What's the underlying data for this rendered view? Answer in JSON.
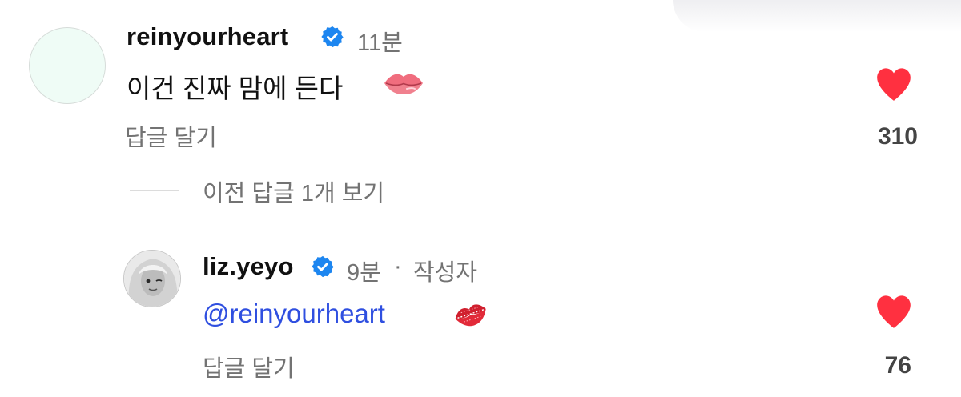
{
  "comment": {
    "username": "reinyourheart",
    "verified_icon": "verified-badge-icon",
    "time": "11분",
    "text": "이건 진짜 맘에 든다",
    "emoji": "lips",
    "reply_label": "답글 달기",
    "likes": "310",
    "heart_color": "#ff3040"
  },
  "view_replies_label": "이전 답글 1개 보기",
  "reply": {
    "username": "liz.yeyo",
    "verified_icon": "verified-badge-icon",
    "time": "9분",
    "separator": "·",
    "author_label": "작성자",
    "mention": "@reinyourheart",
    "emoji": "kiss-mark",
    "reply_label": "답글 달기",
    "likes": "76",
    "heart_color": "#ff3040"
  },
  "colors": {
    "verified": "#1d86f0",
    "mention": "#2f4fe0",
    "secondary_text": "#737373"
  }
}
